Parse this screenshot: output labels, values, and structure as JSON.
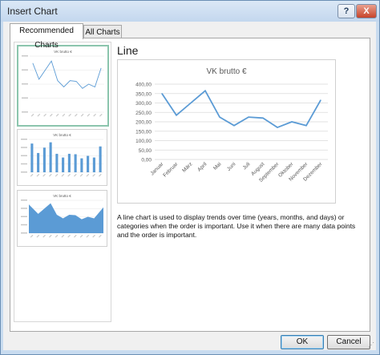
{
  "window": {
    "title": "Insert Chart",
    "help_label": "?",
    "close_label": "X"
  },
  "tabs": [
    {
      "label": "Recommended Charts",
      "active": true
    },
    {
      "label": "All Charts",
      "active": false
    }
  ],
  "thumbnails": [
    {
      "title": "VK brutto €",
      "type": "line",
      "selected": true
    },
    {
      "title": "VK brutto €",
      "type": "bar",
      "selected": false
    },
    {
      "title": "VK brutto €",
      "type": "area",
      "selected": false
    }
  ],
  "detail": {
    "title": "Line",
    "description": "A line chart is used to display trends over time (years, months, and days) or categories when the order is important. Use it when there are many data points and the order is important."
  },
  "buttons": {
    "ok": "OK",
    "cancel": "Cancel"
  },
  "colors": {
    "series": "#5b9bd5",
    "selected_border": "#8bc5ad",
    "titlebar": "#c3d7ee"
  },
  "chart_data": {
    "type": "line",
    "title": "VK brutto €",
    "categories": [
      "Januar",
      "Februar",
      "März",
      "April",
      "Mai",
      "Juni",
      "Juli",
      "August",
      "September",
      "Oktober",
      "November",
      "Dezember"
    ],
    "values": [
      350,
      235,
      300,
      365,
      225,
      180,
      225,
      220,
      170,
      200,
      180,
      315
    ],
    "yticks": [
      "400,00",
      "350,00",
      "300,00",
      "250,00",
      "200,00",
      "150,00",
      "100,00",
      "50,00",
      "0,00"
    ],
    "ylim": [
      0,
      400
    ],
    "grid": true,
    "legend": "none"
  }
}
